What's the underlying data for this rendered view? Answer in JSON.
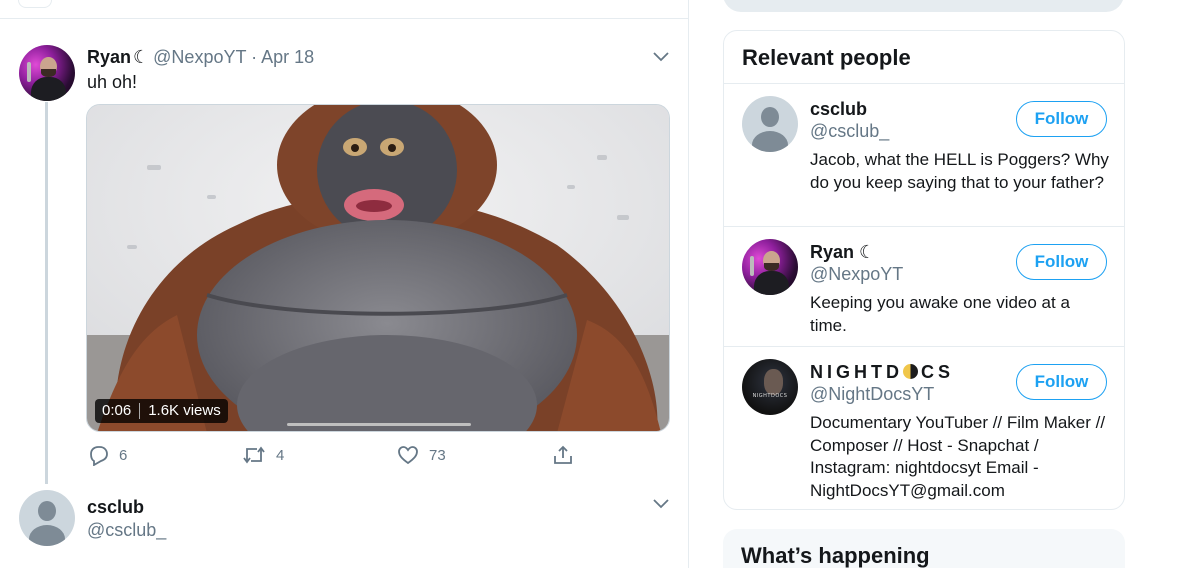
{
  "timeline": {
    "tweet1": {
      "name": "Ryan",
      "moon": "☾",
      "meta": "@NexpoYT · Apr 18",
      "text": "uh oh!",
      "video": {
        "duration": "0:06",
        "views": "1.6K views"
      },
      "actions": {
        "replies": "6",
        "retweets": "4",
        "likes": "73"
      }
    },
    "tweet2": {
      "name": "csclub",
      "handle": "@csclub_"
    }
  },
  "sidebar": {
    "relevant_title": "Relevant people",
    "people": [
      {
        "name": "csclub",
        "handle": "@csclub_",
        "bio": "Jacob, what the HELL is Poggers? Why do you keep saying that to your father?",
        "follow": "Follow"
      },
      {
        "name": "Ryan",
        "moon": "☾",
        "handle": "@NexpoYT",
        "bio": "Keeping you awake one video at a time.",
        "follow": "Follow"
      },
      {
        "name_a": "NIGHTD",
        "name_b": "CS",
        "avatar_text": "NIGHTDOCS",
        "handle": "@NightDocsYT",
        "bio": "Documentary YouTuber // Film Maker // Composer // Host - Snapchat / Instagram: nightdocsyt Email - NightDocsYT@gmail.com",
        "follow": "Follow"
      }
    ],
    "happening_title": "What’s happening"
  },
  "colors": {
    "accent": "#1da1f2",
    "text": "#14171a",
    "muted": "#657786",
    "border": "#e6ecf0"
  }
}
